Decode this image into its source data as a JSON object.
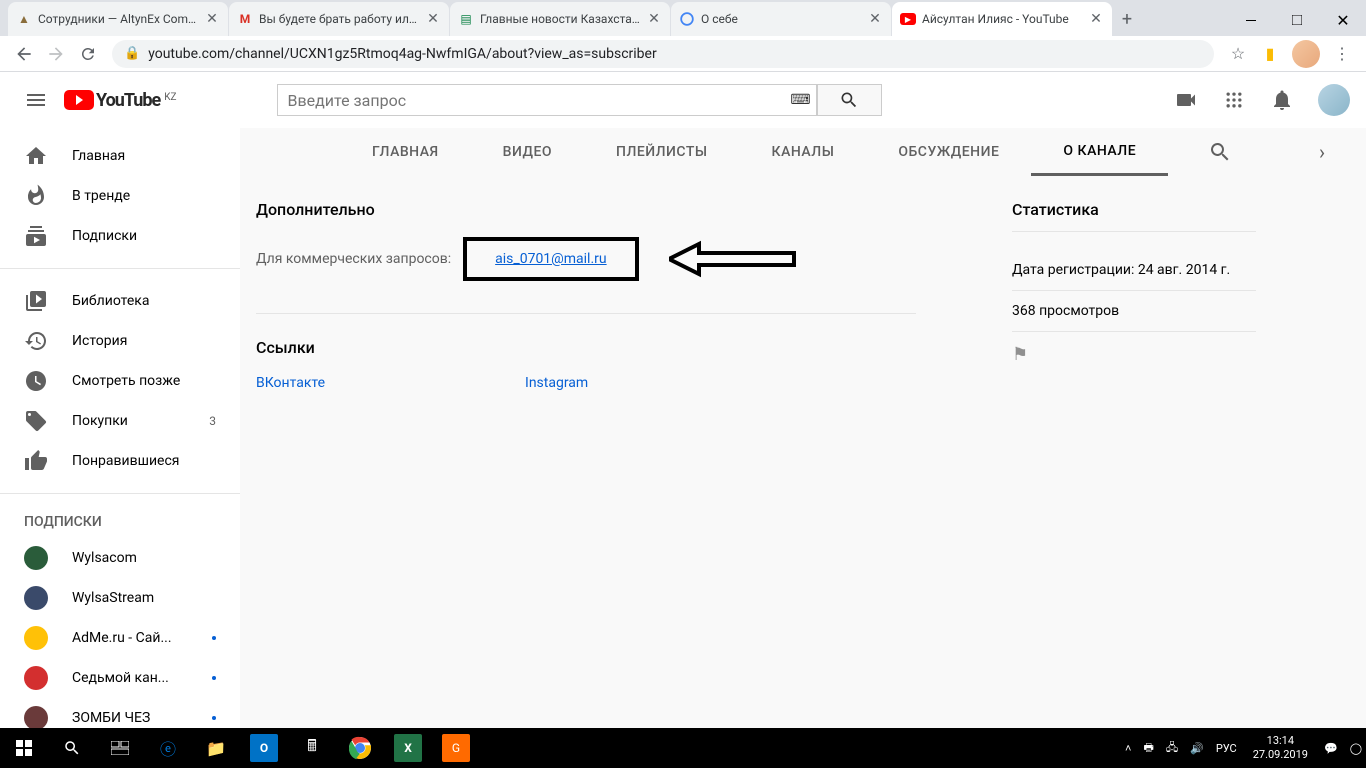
{
  "browser": {
    "tabs": [
      {
        "title": "Сотрудники — AltynEx Compa",
        "favicon": "▲"
      },
      {
        "title": "Вы будете брать работу или е",
        "favicon": "M"
      },
      {
        "title": "Главные новости Казахстана",
        "favicon": "📊"
      },
      {
        "title": "О себе",
        "favicon": "G"
      },
      {
        "title": "Айсултан Илияс - YouTube",
        "favicon": "▶",
        "active": true
      }
    ],
    "url": "youtube.com/channel/UCXN1gz5Rtmoq4ag-NwfmIGA/about?view_as=subscriber"
  },
  "youtube": {
    "logo_text": "YouTube",
    "logo_super": "KZ",
    "search_placeholder": "Введите запрос",
    "sidebar": {
      "items": [
        {
          "label": "Главная",
          "icon": "home"
        },
        {
          "label": "В тренде",
          "icon": "trending"
        },
        {
          "label": "Подписки",
          "icon": "subscriptions"
        }
      ],
      "lib": [
        {
          "label": "Библиотека",
          "icon": "library"
        },
        {
          "label": "История",
          "icon": "history"
        },
        {
          "label": "Смотреть позже",
          "icon": "watch-later"
        },
        {
          "label": "Покупки",
          "icon": "purchases",
          "count": "3"
        },
        {
          "label": "Понравившиеся",
          "icon": "liked"
        }
      ],
      "subs_heading": "ПОДПИСКИ",
      "subs": [
        {
          "label": "Wylsacom",
          "color": "#2a5c3a"
        },
        {
          "label": "WylsaStream",
          "color": "#3a4a6a"
        },
        {
          "label": "AdMe.ru - Сай...",
          "color": "#ffc107",
          "dot": true
        },
        {
          "label": "Седьмой кан...",
          "color": "#d32f2f",
          "dot": true
        },
        {
          "label": "ЗОМБИ ЧЕЗ",
          "color": "#6a3a3a",
          "dot": true
        }
      ]
    },
    "channel_tabs": [
      "ГЛАВНАЯ",
      "ВИДЕО",
      "ПЛЕЙЛИСТЫ",
      "КАНАЛЫ",
      "ОБСУЖДЕНИЕ",
      "О КАНАЛЕ"
    ],
    "about": {
      "additional_heading": "Дополнительно",
      "commercial_label": "Для коммерческих запросов:",
      "email": "ais_0701@mail.ru",
      "links_heading": "Ссылки",
      "links": [
        "ВКонтакте",
        "Instagram"
      ],
      "stats_heading": "Статистика",
      "reg_date": "Дата регистрации: 24 авг. 2014 г.",
      "views": "368 просмотров"
    }
  },
  "taskbar": {
    "lang": "РУС",
    "time": "13:14",
    "date": "27.09.2019"
  }
}
